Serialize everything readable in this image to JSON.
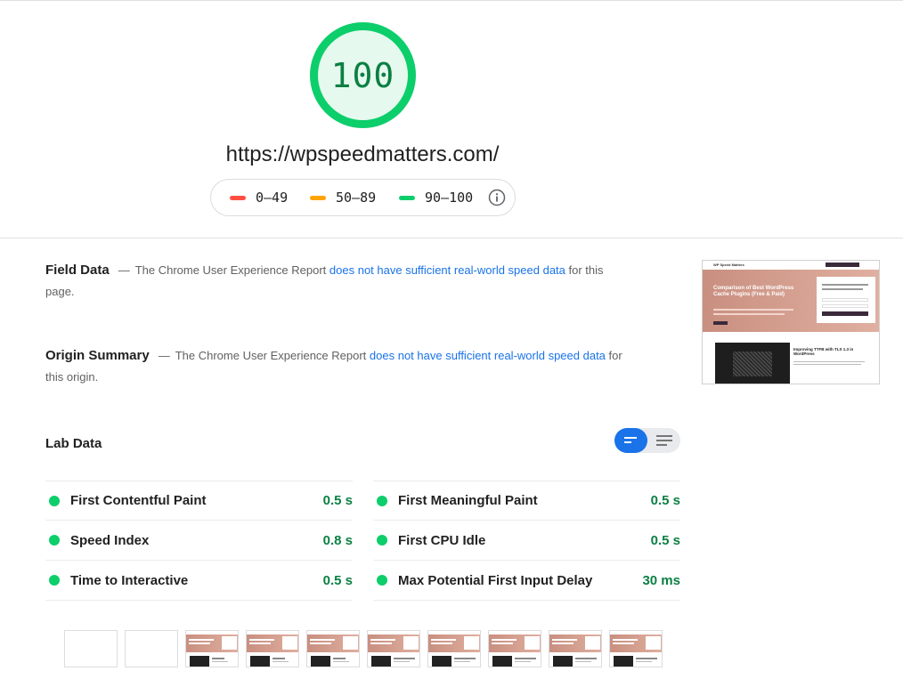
{
  "score": {
    "value": "100",
    "percent": 100,
    "color": "#0cce6b",
    "track_color": "#e6f9ee"
  },
  "url": "https://wpspeedmatters.com/",
  "legend": {
    "poor": {
      "label": "0–49",
      "color": "#ff4e42"
    },
    "average": {
      "label": "50–89",
      "color": "#ffa400"
    },
    "good": {
      "label": "90–100",
      "color": "#0cce6b"
    },
    "info_icon": "info-icon"
  },
  "field_data": {
    "title": "Field Data",
    "dash": "—",
    "text_before": "The Chrome User Experience Report",
    "link": "does not have sufficient real-world speed data",
    "text_after": "for this page."
  },
  "origin_summary": {
    "title": "Origin Summary",
    "dash": "—",
    "text_before": "The Chrome User Experience Report",
    "link": "does not have sufficient real-world speed data",
    "text_after": "for this origin."
  },
  "thumbnail": {
    "site_name": "WP Speed Matters",
    "hero_title": "Comparison of Best WordPress Cache Plugins (Free & Paid)",
    "post_title": "Improving TTFB with TLS 1.3 in WordPress"
  },
  "lab_data": {
    "title": "Lab Data",
    "toggle_icons": [
      "bars-view-icon",
      "list-view-icon"
    ],
    "metrics_left": [
      {
        "name": "First Contentful Paint",
        "value": "0.5 s"
      },
      {
        "name": "Speed Index",
        "value": "0.8 s"
      },
      {
        "name": "Time to Interactive",
        "value": "0.5 s"
      }
    ],
    "metrics_right": [
      {
        "name": "First Meaningful Paint",
        "value": "0.5 s"
      },
      {
        "name": "First CPU Idle",
        "value": "0.5 s"
      },
      {
        "name": "Max Potential First Input Delay",
        "value": "30 ms"
      }
    ]
  },
  "filmstrip": {
    "frames": 10,
    "blank_frames": 2
  }
}
